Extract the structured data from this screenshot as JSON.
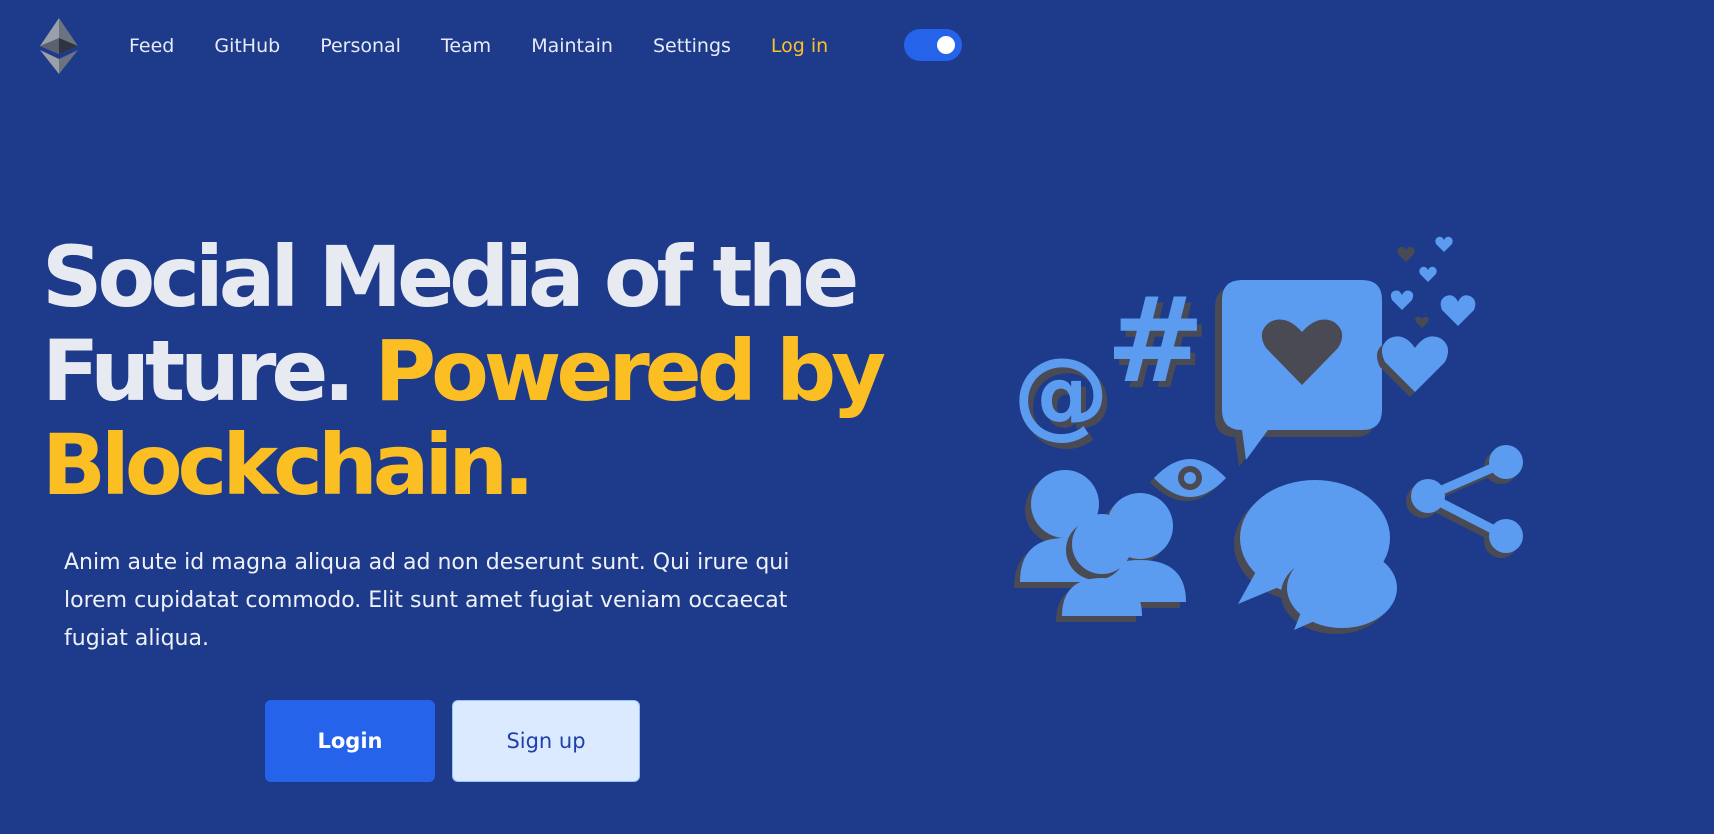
{
  "nav": {
    "logo_icon": "ethereum-logo-icon",
    "links": [
      "Feed",
      "GitHub",
      "Personal",
      "Team",
      "Maintain",
      "Settings"
    ],
    "login_label": "Log in",
    "theme_toggle": {
      "on": true,
      "color": "#2563eb"
    }
  },
  "hero": {
    "title_white": "Social Media of the Future.",
    "title_yellow": "Powered by Blockchain.",
    "subtitle": "Anim aute id magna aliqua ad ad non deserunt sunt. Qui irure qui lorem cupidatat commodo. Elit sunt amet fugiat veniam occaecat fugiat aliqua.",
    "login_button": "Login",
    "signup_button": "Sign up"
  },
  "illustration": {
    "icon": "social-media-illustration",
    "at_sign": "@",
    "hash_sign": "#"
  },
  "colors": {
    "background": "#1e3a8a",
    "accent_yellow": "#fbbf24",
    "primary_blue": "#2563eb",
    "illustration_blue": "#5b9cf0",
    "illustration_shadow": "#4a4a55"
  }
}
